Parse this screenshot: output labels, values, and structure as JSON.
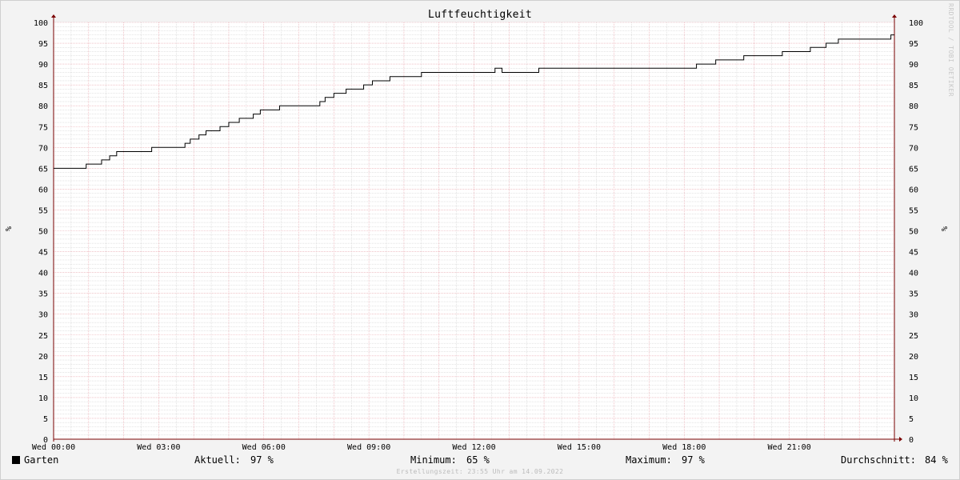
{
  "chart_data": {
    "type": "line",
    "title": "Luftfeuchtigkeit",
    "ylabel": "%",
    "ylim": [
      0,
      100
    ],
    "y_ticks": [
      0,
      5,
      10,
      15,
      20,
      25,
      30,
      35,
      40,
      45,
      50,
      55,
      60,
      65,
      70,
      75,
      80,
      85,
      90,
      95,
      100
    ],
    "x_ticks": [
      "Wed 00:00",
      "Wed 03:00",
      "Wed 06:00",
      "Wed 09:00",
      "Wed 12:00",
      "Wed 15:00",
      "Wed 18:00",
      "Wed 21:00"
    ],
    "x_range_hours": [
      0,
      24
    ],
    "grid": true,
    "series": [
      {
        "name": "Garten",
        "color": "#000000",
        "x_hours": [
          0,
          0.93,
          1.37,
          1.6,
          1.8,
          2.8,
          3.75,
          3.9,
          4.15,
          4.35,
          4.75,
          5.0,
          5.3,
          5.7,
          5.9,
          5.98,
          6.45,
          7.6,
          7.75,
          8.0,
          8.35,
          8.85,
          9.1,
          9.6,
          9.92,
          10.5,
          10.55,
          11.8,
          12.0,
          12.6,
          12.7,
          12.8,
          12.9,
          13.8,
          13.85,
          18.3,
          18.35,
          18.9,
          19.05,
          19.7,
          19.8,
          20.6,
          20.8,
          21.1,
          21.6,
          22.05,
          22.4,
          23.0,
          23.9,
          24.0
        ],
        "values": [
          65,
          66,
          67,
          68,
          69,
          70,
          71,
          72,
          73,
          74,
          75,
          76,
          77,
          78,
          79,
          79,
          80,
          81,
          82,
          83,
          84,
          85,
          86,
          87,
          87,
          88,
          88,
          88,
          88,
          89,
          89,
          88,
          88,
          88,
          89,
          89,
          90,
          91,
          91,
          92,
          92,
          92,
          93,
          93,
          94,
          95,
          96,
          96,
          97,
          97
        ]
      }
    ]
  },
  "legend": {
    "series_name": "Garten",
    "current_label": "Aktuell:",
    "current_value": "97 %",
    "min_label": "Minimum:",
    "min_value": "65 %",
    "max_label": "Maximum:",
    "max_value": "97 %",
    "avg_label": "Durchschnitt:",
    "avg_value": "84 %"
  },
  "watermark": "RRDTOOL / TOBI OETIKER",
  "footer": "Erstellungszeit: 23:55 Uhr am 14.09.2022",
  "colors": {
    "background": "#f3f3f3",
    "plot_background": "#ffffff",
    "major_grid": "#e8a0a8",
    "minor_grid": "#c8c8c8",
    "axis": "#7a0000",
    "line": "#000000"
  }
}
